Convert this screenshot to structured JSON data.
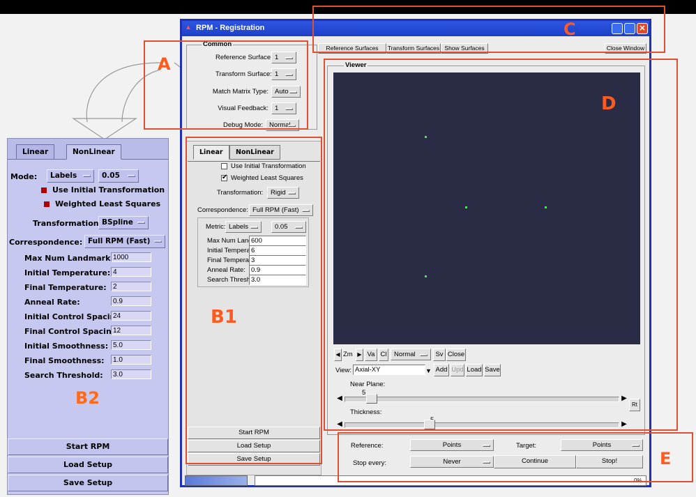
{
  "annotations": {
    "a": "A",
    "b1": "B1",
    "b2": "B2",
    "c": "C",
    "d": "D",
    "e": "E"
  },
  "window": {
    "title": "RPM - Registration"
  },
  "toolbar": {
    "ref_surfaces": "Reference Surfaces",
    "transform_surfaces": "Transform Surfaces",
    "show_surfaces": "Show Surfaces",
    "close_window": "Close Window"
  },
  "common": {
    "title": "Common",
    "reference_surface_label": "Reference Surface:",
    "reference_surface_value": "1",
    "transform_surface_label": "Transform Surface:",
    "transform_surface_value": "1",
    "match_matrix_label": "Match Matrix Type:",
    "match_matrix_value": "Auto",
    "visual_feedback_label": "Visual Feedback:",
    "visual_feedback_value": "1",
    "debug_mode_label": "Debug Mode:",
    "debug_mode_value": "Normal"
  },
  "b1": {
    "tab_linear": "Linear",
    "tab_nonlinear": "NonLinear",
    "use_initial": "Use Initial Transformation",
    "use_initial_checked": false,
    "weighted": "Weighted Least Squares",
    "weighted_checked": true,
    "transformation_label": "Transformation:",
    "transformation_value": "Rigid",
    "correspondence_label": "Correspondence:",
    "correspondence_value": "Full RPM (Fast)",
    "metric_label": "Metric:",
    "metric_value": "Labels",
    "metric_value2": "0.05",
    "max_landmarks_label": "Max Num Landmarks:",
    "max_landmarks": "600",
    "init_temp_label": "Initial Temperature:",
    "init_temp": "6",
    "final_temp_label": "Final Temperature:",
    "final_temp": "3",
    "anneal_label": "Anneal Rate:",
    "anneal": "0.9",
    "search_label": "Search Threshold:",
    "search": "3.0",
    "start": "Start RPM",
    "load": "Load Setup",
    "save": "Save Setup"
  },
  "b2": {
    "tab_linear": "Linear",
    "tab_nonlinear": "NonLinear",
    "mode_label": "Mode:",
    "mode_value": "Labels",
    "mode_value2": "0.05",
    "use_initial": "Use Initial Transformation",
    "weighted": "Weighted Least Squares",
    "transformation_label": "Transformation:",
    "transformation_value": "BSpline",
    "correspondence_label": "Correspondence:",
    "correspondence_value": "Full RPM (Fast)",
    "fields": [
      {
        "label": "Max Num Landmarks:",
        "value": "1000"
      },
      {
        "label": "Initial Temperature:",
        "value": "4"
      },
      {
        "label": "Final Temperature:",
        "value": "2"
      },
      {
        "label": "Anneal Rate:",
        "value": "0.9"
      },
      {
        "label": "Initial Control Spacing:",
        "value": "24"
      },
      {
        "label": "Final Control Spacing:",
        "value": "12"
      },
      {
        "label": "Initial Smoothness:",
        "value": "5.0"
      },
      {
        "label": "Final Smoothness:",
        "value": "1.0"
      },
      {
        "label": "Search Threshold:",
        "value": "3.0"
      }
    ],
    "start": "Start RPM",
    "load": "Load Setup",
    "save": "Save Setup"
  },
  "viewer": {
    "title": "Viewer",
    "zm": "Zm",
    "va": "Va",
    "cl": "Cl",
    "mode": "Normal",
    "sv": "Sv",
    "close": "Close",
    "view_label": "View:",
    "view_value": "Axial-XY",
    "add": "Add",
    "upd": "Upd",
    "load": "Load",
    "save": "Save",
    "near_plane_label": "Near Plane:",
    "near_plane_value": "5",
    "near_plane_level": 0.08,
    "thickness_label": "Thickness:",
    "thickness_value": "5",
    "thickness_level": 0.3,
    "rt": "Rt"
  },
  "bottom": {
    "reference_label": "Reference:",
    "reference_value": "Points",
    "target_label": "Target:",
    "target_value": "Points",
    "stop_every_label": "Stop every:",
    "stop_every_value": "Never",
    "continue": "Continue",
    "stop": "Stop!",
    "progress": "0%"
  }
}
